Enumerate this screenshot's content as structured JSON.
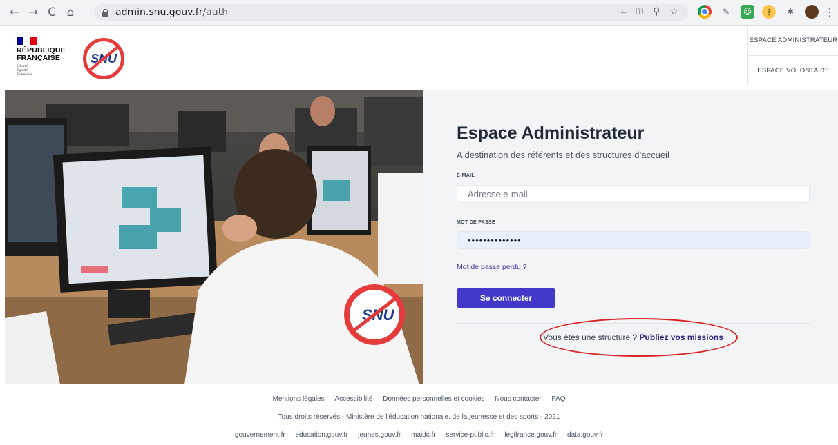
{
  "browser": {
    "url_host": "admin.snu.gouv.fr",
    "url_path": "/auth",
    "nav": {
      "back": "←",
      "forward": "→",
      "reload": "C",
      "home": "⌂"
    },
    "addr_icons": [
      "⌗",
      "⚿",
      "⚲",
      "☆"
    ],
    "menu": "⋮"
  },
  "header": {
    "republique": [
      "RÉPUBLIQUE",
      "FRANÇAISE"
    ],
    "motto": [
      "Liberté",
      "Égalité",
      "Fraternité"
    ],
    "snu_logo_text": "SNU",
    "espace_admin": "ESPACE ADMINISTRATEUR",
    "espace_volontaire": "ESPACE VOLONTAIRE"
  },
  "login": {
    "title": "Espace Administrateur",
    "subtitle": "A destination des référents et des structures d’accueil",
    "email_label": "E-MAIL",
    "email_placeholder": "Adresse e-mail",
    "password_label": "MOT DE PASSE",
    "password_value": "••••••••••••••",
    "forgot": "Mot de passe perdu ?",
    "submit": "Se connecter",
    "structure_prefix": "Vous êtes une structure ?",
    "structure_link": "Publiez vos missions"
  },
  "footer": {
    "links_row1": [
      "Mentions légales",
      "Accessibilité",
      "Données personnelles et cookies",
      "Nous contacter",
      "FAQ"
    ],
    "copyright": "Tous droits réservés - Ministère de l'éducation nationale, de la jeunesse et des sports - 2021",
    "links_row3": [
      "gouvernement.fr",
      "education.gouv.fr",
      "jeunes.gouv.fr",
      "majdc.fr",
      "service-public.fr",
      "legifrance.gouv.fr",
      "data.gouv.fr"
    ]
  },
  "colors": {
    "accent": "#4338ca",
    "panel_bg": "#f3f4f6",
    "highlight_ring": "#d92323",
    "snu_red": "#e63b3b",
    "snu_blue": "#1e3a8a"
  }
}
